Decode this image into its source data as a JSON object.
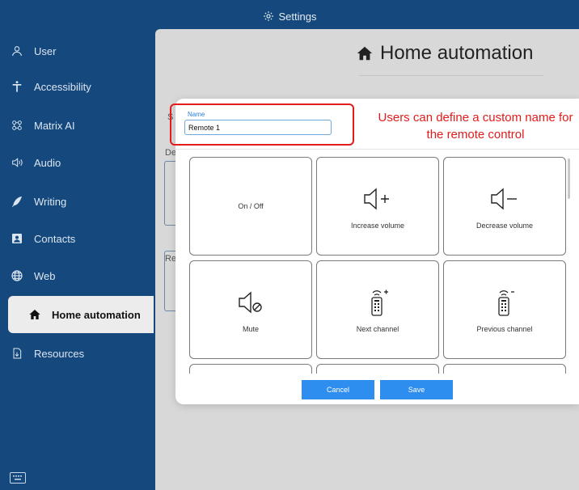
{
  "header": {
    "title": "Settings",
    "icon": "gear-icon"
  },
  "sidebar": {
    "items": [
      {
        "label": "User",
        "icon": "user-icon"
      },
      {
        "label": "Accessibility",
        "icon": "accessibility-icon"
      },
      {
        "label": "Matrix AI",
        "icon": "matrix-ai-icon"
      },
      {
        "label": "Audio",
        "icon": "speaker-icon"
      },
      {
        "label": "Writing",
        "icon": "feather-icon"
      },
      {
        "label": "Contacts",
        "icon": "contacts-icon"
      },
      {
        "label": "Web",
        "icon": "globe-icon"
      },
      {
        "label": "Home automation",
        "icon": "home-icon",
        "active": true
      },
      {
        "label": "Resources",
        "icon": "resources-icon"
      }
    ],
    "keyboard_icon": "keyboard-icon"
  },
  "main": {
    "title": "Home automation",
    "title_icon": "home-icon",
    "background_fragments": [
      "S",
      "De",
      "Re"
    ]
  },
  "dialog": {
    "name_label": "Name",
    "name_value": "Remote 1",
    "annotation": "Users can define a custom name for the remote control",
    "tiles": [
      {
        "label": "On / Off",
        "icon": "none"
      },
      {
        "label": "Increase volume",
        "icon": "volume-up-icon"
      },
      {
        "label": "Decrease volume",
        "icon": "volume-down-icon"
      },
      {
        "label": "Mute",
        "icon": "mute-icon"
      },
      {
        "label": "Next channel",
        "icon": "remote-plus-icon"
      },
      {
        "label": "Previous channel",
        "icon": "remote-minus-icon"
      }
    ],
    "cancel_label": "Cancel",
    "save_label": "Save"
  },
  "colors": {
    "sidebar_bg": "#15487c",
    "accent": "#2e8ef0",
    "annotation": "#e31b1b"
  }
}
